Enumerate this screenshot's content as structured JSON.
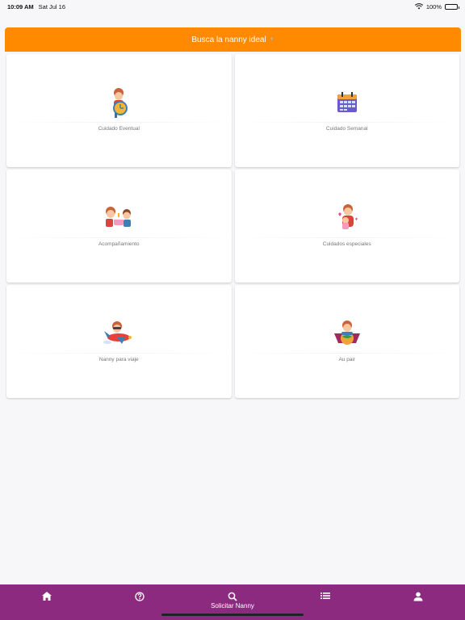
{
  "status": {
    "time": "10:09 AM",
    "date": "Sat Jul 16",
    "battery": "100%"
  },
  "header": {
    "title": "Busca la nanny ideal"
  },
  "cards": [
    {
      "label": "Cuidado Eventual",
      "icon": "girl-with-clock-icon"
    },
    {
      "label": "Cuidado Semanal",
      "icon": "calendar-icon"
    },
    {
      "label": "Acompañamiento",
      "icon": "kids-with-cake-icon"
    },
    {
      "label": "Cuidados especiales",
      "icon": "nanny-hugging-child-icon"
    },
    {
      "label": "Nanny para viaje",
      "icon": "nanny-on-airplane-icon"
    },
    {
      "label": "Au pair",
      "icon": "nanny-with-globe-icon"
    }
  ],
  "nav": {
    "items": [
      {
        "icon": "home-icon",
        "label": ""
      },
      {
        "icon": "help-icon",
        "label": ""
      },
      {
        "icon": "search-icon",
        "label": "Solicitar Nanny"
      },
      {
        "icon": "list-icon",
        "label": ""
      },
      {
        "icon": "person-icon",
        "label": ""
      }
    ]
  },
  "colors": {
    "header": "#ff8a00",
    "nav": "#8c2a7f",
    "background": "#f7f7f9"
  }
}
